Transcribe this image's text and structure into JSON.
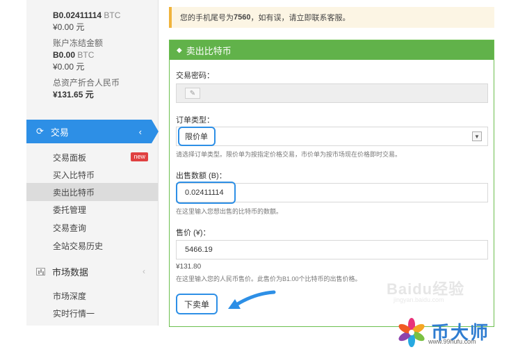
{
  "account": {
    "btc_available": "B0.02411114",
    "btc_unit": "BTC",
    "cny_available": "¥0.00 元",
    "frozen_label": "账户冻结金额",
    "btc_frozen": "B0.00",
    "cny_frozen": "¥0.00 元",
    "total_label": "总资产折合人民币",
    "total_value": "¥131.65 元"
  },
  "nav": {
    "trade_label": "交易",
    "trade_items": [
      {
        "label": "交易面板",
        "badge": "new"
      },
      {
        "label": "买入比特币"
      },
      {
        "label": "卖出比特币"
      },
      {
        "label": "委托管理"
      },
      {
        "label": "交易查询"
      },
      {
        "label": "全站交易历史"
      }
    ],
    "market_label": "市场数据",
    "market_items": [
      {
        "label": "市场深度"
      },
      {
        "label": "实时行情一"
      }
    ]
  },
  "notice": {
    "prefix": "您的手机尾号为 ",
    "phone_tail": "7560",
    "suffix": "，如有误，请立即联系客服。"
  },
  "panel": {
    "title": "卖出比特币",
    "password_label": "交易密码：",
    "order_type_label": "订单类型：",
    "order_type_value": "限价单",
    "order_type_help": "请选择订单类型。限价单为按指定价格交易，市价单为按市场现在价格即时交易。",
    "amount_label": "出售数额 (B)：",
    "amount_value": "0.02411114",
    "amount_help": "在这里输入您想出售的比特币的数额。",
    "price_label": "售价 (¥)：",
    "price_value": "5466.19",
    "total_value": "¥131.80",
    "price_help": "在这里输入您的人民币售价。此售价为B1.00个比特币的出售价格。",
    "submit_label": "下卖单"
  },
  "watermark": {
    "text": "Baidu经验",
    "sub": "jingyan.baidu.com"
  },
  "logo": {
    "text": "币大师",
    "url": "www.99hufu.com"
  },
  "colors": {
    "accent_blue": "#2d8fe6",
    "panel_green": "#61b24a",
    "notice_bg": "#fcf5e4",
    "badge_red": "#e04040",
    "logo_blue": "#2e7cd0"
  }
}
